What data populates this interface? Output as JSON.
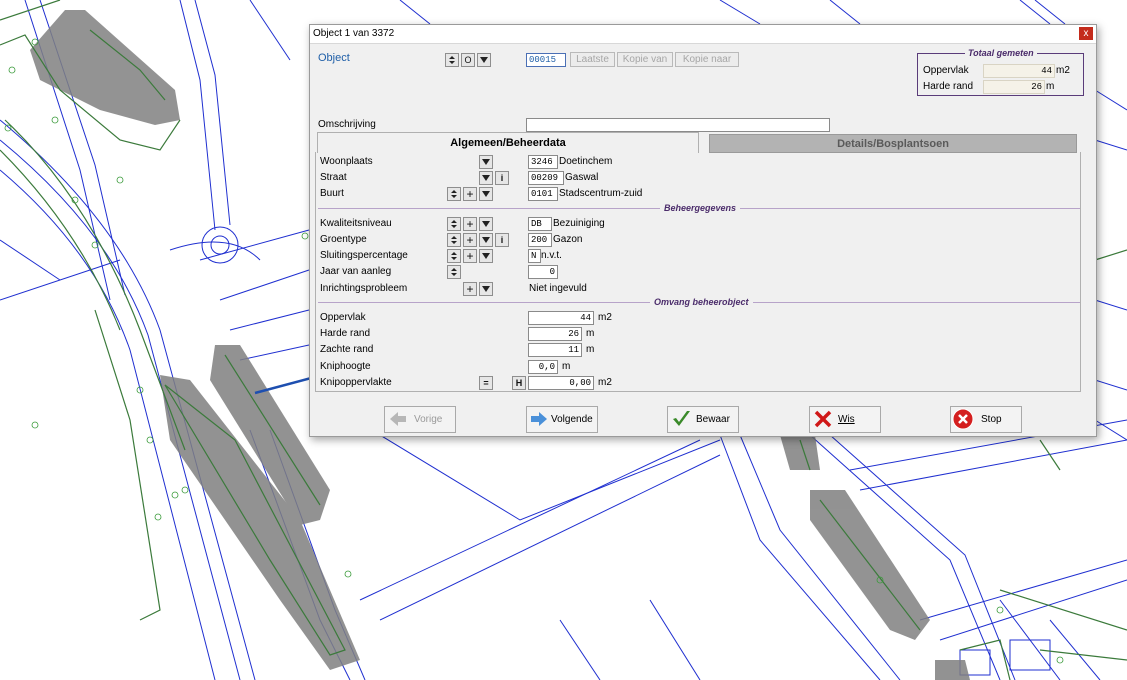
{
  "window": {
    "title": "Object 1 van 3372",
    "close_glyph": "x"
  },
  "object": {
    "label": "Object",
    "number": "00015",
    "buttons": [
      "Laatste",
      "Kopie van",
      "Kopie naar"
    ],
    "nav_letter": "O"
  },
  "totals": {
    "title": "Totaal gemeten",
    "rows": [
      {
        "label": "Oppervlak",
        "value": "44",
        "unit": "m2"
      },
      {
        "label": "Harde rand",
        "value": "26",
        "unit": "m"
      }
    ]
  },
  "omschrijving": {
    "label": "Omschrijving",
    "value": ""
  },
  "tabs": [
    {
      "label": "Algemeen/Beheerdata",
      "active": true
    },
    {
      "label": "Details/Bosplantsoen",
      "active": false
    }
  ],
  "general": [
    {
      "label": "Woonplaats",
      "code": "3246",
      "text": "Doetinchem"
    },
    {
      "label": "Straat",
      "code": "00209",
      "text": "Gaswal"
    },
    {
      "label": "Buurt",
      "code": "0101",
      "text": "Stadscentrum-zuid"
    }
  ],
  "beheer": {
    "header": "Beheergegevens",
    "rows": [
      {
        "label": "Kwaliteitsniveau",
        "code": "DB",
        "text": "Bezuiniging"
      },
      {
        "label": "Groentype",
        "code": "200",
        "text": "Gazon"
      },
      {
        "label": "Sluitingspercentage",
        "code": "N",
        "text": "n.v.t."
      },
      {
        "label": "Jaar van aanleg",
        "code": "0",
        "text": ""
      },
      {
        "label": "Inrichtingsprobleem",
        "code": "",
        "text": "Niet ingevuld"
      }
    ]
  },
  "omvang": {
    "header": "Omvang beheerobject",
    "rows": [
      {
        "label": "Oppervlak",
        "value": "44",
        "unit": "m2"
      },
      {
        "label": "Harde rand",
        "value": "26",
        "unit": "m"
      },
      {
        "label": "Zachte rand",
        "value": "11",
        "unit": "m"
      },
      {
        "label": "Kniphoogte",
        "value": "0,0",
        "unit": "m"
      },
      {
        "label": "Knipoppervlakte",
        "value": "0,00",
        "unit": "m2",
        "h_label": "H",
        "eq_label": "="
      }
    ]
  },
  "actions": [
    {
      "label": "Vorige",
      "enabled": false,
      "icon": "arrow-left-icon"
    },
    {
      "label": "Volgende",
      "enabled": true,
      "icon": "arrow-right-icon"
    },
    {
      "label": "Bewaar",
      "enabled": true,
      "icon": "checkmark-icon"
    },
    {
      "label": "Wis",
      "enabled": true,
      "icon": "red-x-icon"
    },
    {
      "label": "Stop",
      "enabled": true,
      "icon": "stop-icon"
    }
  ],
  "colors": {
    "map_lines": "#1f2fd0",
    "map_green": "#3b7a3b",
    "map_fill": "#808080",
    "dialog_bg": "#f0f0f0",
    "section_header": "#4b2c6b",
    "object_label": "#1f5fa8"
  }
}
